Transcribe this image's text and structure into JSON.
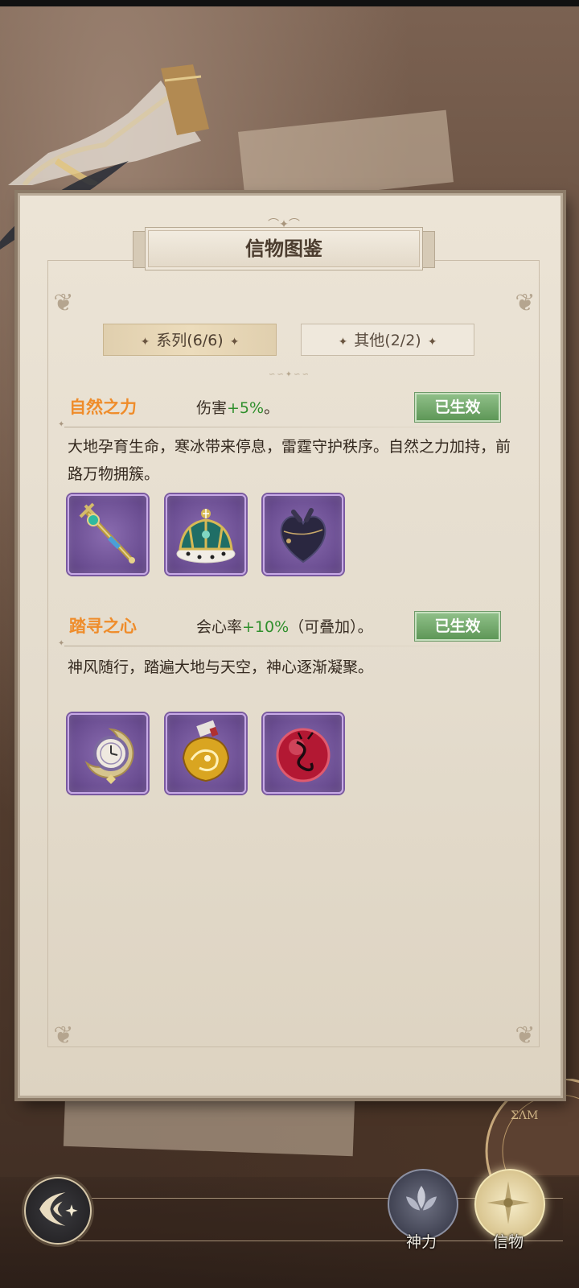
{
  "page": {
    "title": "信物图鉴"
  },
  "tabs": [
    {
      "label": "系列(6/6)",
      "active": true
    },
    {
      "label": "其他(2/2)",
      "active": false
    }
  ],
  "sets": [
    {
      "name": "自然之力",
      "effect_prefix": "伤害",
      "effect_value": "+5%",
      "effect_suffix": "。",
      "status": "已生效",
      "description": "大地孕育生命，寒冰带来停息，雷霆守护秩序。自然之力加持，前路万物拥簇。",
      "items": [
        {
          "icon": "scepter-icon"
        },
        {
          "icon": "crown-icon"
        },
        {
          "icon": "heart-pouch-icon"
        }
      ]
    },
    {
      "name": "踏寻之心",
      "effect_prefix": "会心率",
      "effect_value": "+10%",
      "effect_suffix": "（可叠加）。",
      "status": "已生效",
      "description": "神风随行，踏遍大地与天空，神心逐渐凝聚。",
      "items": [
        {
          "icon": "moon-clock-icon"
        },
        {
          "icon": "golden-dragon-icon"
        },
        {
          "icon": "red-orb-icon"
        }
      ]
    }
  ],
  "bottom_nav": [
    {
      "label": "神力",
      "active": false
    },
    {
      "label": "信物",
      "active": true
    }
  ],
  "colors": {
    "set_name": "#ef8c2a",
    "effect_value": "#2f8f2c",
    "badge": "#6da566",
    "item_frame": "#6b4e92"
  }
}
